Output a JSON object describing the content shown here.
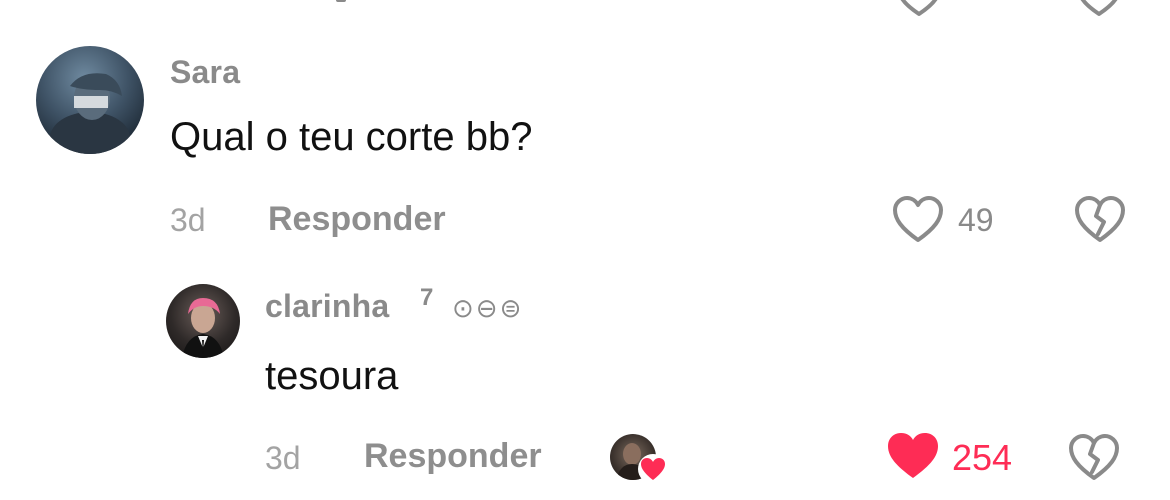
{
  "comment_1": {
    "username": "Sara",
    "text": "Qual o teu corte bb?",
    "time": "3d",
    "reply_label": "Responder",
    "like_count": "49",
    "liked": false
  },
  "reply_1": {
    "username": "clarinha",
    "superscript": "7",
    "badges": [
      "⊙",
      "⊖",
      "⊜"
    ],
    "text": "tesoura",
    "time": "3d",
    "reply_label": "Responder",
    "like_count": "254",
    "liked": true
  },
  "colors": {
    "liked": "#fe2c55",
    "muted": "#8a8a8a"
  },
  "icons": {
    "like": "heart-outline-icon",
    "liked": "heart-filled-icon",
    "dislike": "broken-heart-icon",
    "creator_liked": "heart-badge-icon"
  }
}
